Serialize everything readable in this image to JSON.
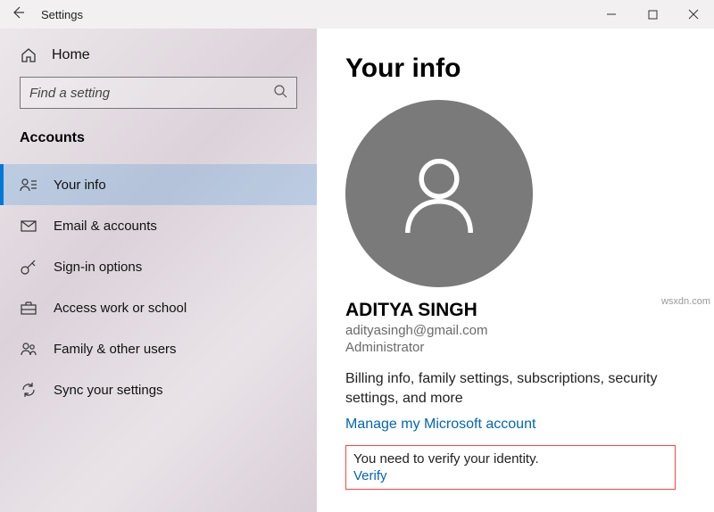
{
  "window": {
    "title": "Settings"
  },
  "sidebar": {
    "home": "Home",
    "search_placeholder": "Find a setting",
    "category": "Accounts",
    "items": [
      {
        "label": "Your info"
      },
      {
        "label": "Email & accounts"
      },
      {
        "label": "Sign-in options"
      },
      {
        "label": "Access work or school"
      },
      {
        "label": "Family & other users"
      },
      {
        "label": "Sync your settings"
      }
    ]
  },
  "main": {
    "heading": "Your info",
    "user_name": "ADITYA SINGH",
    "user_email": "adityasingh@gmail.com",
    "user_role": "Administrator",
    "billing_text": "Billing info, family settings, subscriptions, security settings, and more",
    "manage_link": "Manage my Microsoft account",
    "verify_msg": "You need to verify your identity.",
    "verify_link": "Verify"
  },
  "watermark": "wsxdn.com"
}
